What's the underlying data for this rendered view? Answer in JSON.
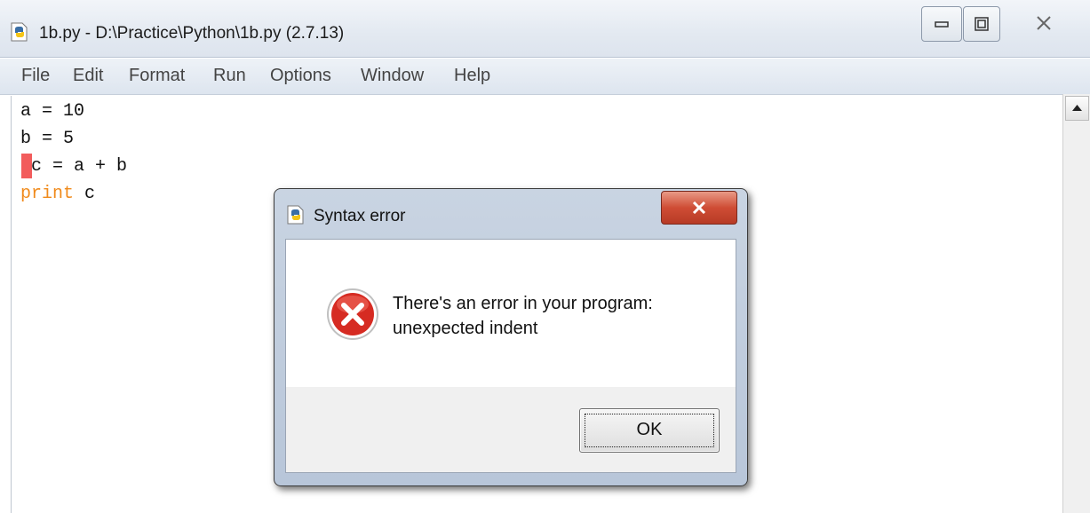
{
  "window": {
    "title": "1b.py - D:\\Practice\\Python\\1b.py (2.7.13)",
    "icon": "python-file-icon"
  },
  "menu": [
    "File",
    "Edit",
    "Format",
    "Run",
    "Options",
    "Window",
    "Help"
  ],
  "code": [
    {
      "text": "a = 10"
    },
    {
      "text": "b = 5"
    },
    {
      "text": " c = a + b"
    },
    {
      "keyword": "print",
      "rest": " c"
    }
  ],
  "dialog": {
    "title": "Syntax error",
    "message_line1": "There's an error in your program:",
    "message_line2": "unexpected indent",
    "ok_label": "OK",
    "icon": "error-icon"
  },
  "colors": {
    "keyword": "#f08a1b",
    "error_marker": "#f25c5c",
    "dialog_close": "#cf4d35"
  }
}
